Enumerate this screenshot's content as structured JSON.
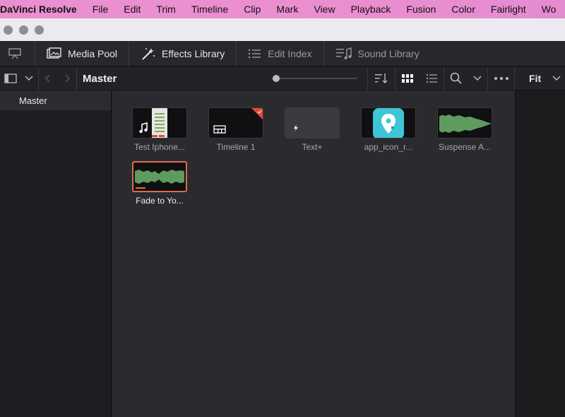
{
  "menubar": {
    "app_name": "DaVinci Resolve",
    "items": [
      "File",
      "Edit",
      "Trim",
      "Timeline",
      "Clip",
      "Mark",
      "View",
      "Playback",
      "Fusion",
      "Color",
      "Fairlight",
      "Wo"
    ]
  },
  "toolbar": {
    "media_pool": "Media Pool",
    "effects_library": "Effects Library",
    "edit_index": "Edit Index",
    "sound_library": "Sound Library"
  },
  "subbar": {
    "bin_title": "Master",
    "zoom_level": 0.05,
    "viewer_fit": "Fit"
  },
  "sidebar": {
    "items": [
      {
        "label": "Master"
      }
    ]
  },
  "clips": [
    {
      "label": "Test Iphone...",
      "icon": "music-note-icon"
    },
    {
      "label": "Timeline 1",
      "icon": "timeline-icon"
    },
    {
      "label": "Text+",
      "icon": "fusion-title-icon"
    },
    {
      "label": "app_icon_r...",
      "icon": "app-icon-image"
    },
    {
      "label": "Suspense A...",
      "icon": "audio-waveform"
    },
    {
      "label": "Fade to Yo...",
      "icon": "audio-waveform",
      "selected": true
    }
  ],
  "colors": {
    "menubar": "#e98fcf",
    "accent": "#e06a4a",
    "waveform": "#5f9a5f",
    "app_icon": "#3fc4d8"
  }
}
